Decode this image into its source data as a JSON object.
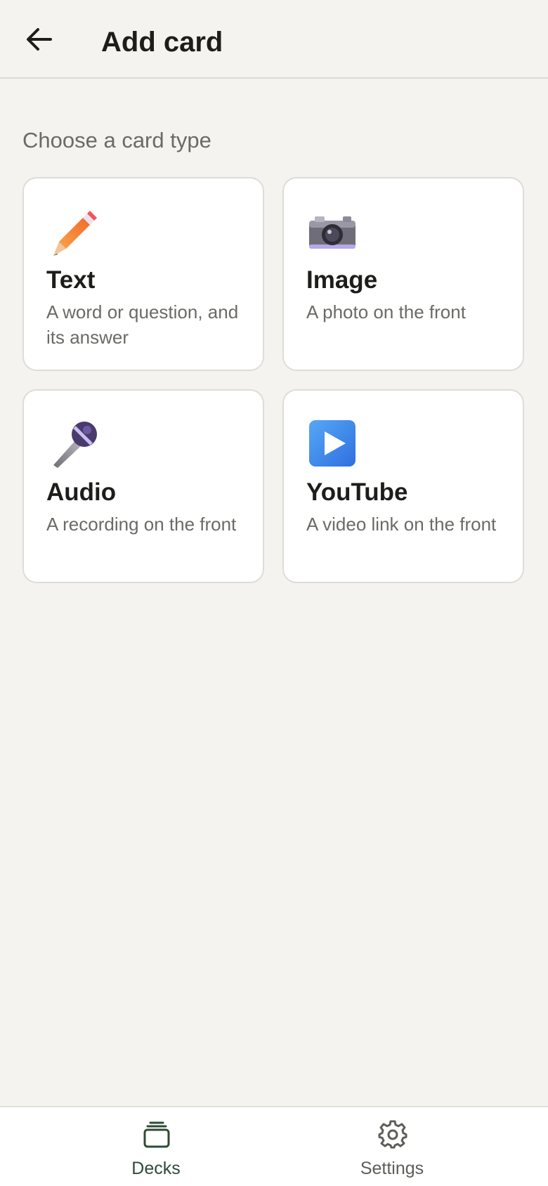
{
  "header": {
    "title": "Add card",
    "back_icon": "arrow-left-icon"
  },
  "section_label": "Choose a card type",
  "card_types": [
    {
      "title": "Text",
      "description": "A word or question, and its answer",
      "icon": "pencil-icon"
    },
    {
      "title": "Image",
      "description": "A photo on the front",
      "icon": "camera-icon"
    },
    {
      "title": "Audio",
      "description": "A recording on the front",
      "icon": "microphone-icon"
    },
    {
      "title": "YouTube",
      "description": "A video link on the front",
      "icon": "play-button-icon"
    }
  ],
  "bottom_nav": {
    "items": [
      {
        "label": "Decks",
        "icon": "decks-icon",
        "active": true
      },
      {
        "label": "Settings",
        "icon": "gear-icon",
        "active": false
      }
    ],
    "active_color": "#2f4a35",
    "inactive_color": "#5e5d59"
  },
  "colors": {
    "background": "#f4f3ef",
    "card_background": "#ffffff",
    "text_primary": "#1d1d1b",
    "text_secondary": "#6b6a66"
  }
}
